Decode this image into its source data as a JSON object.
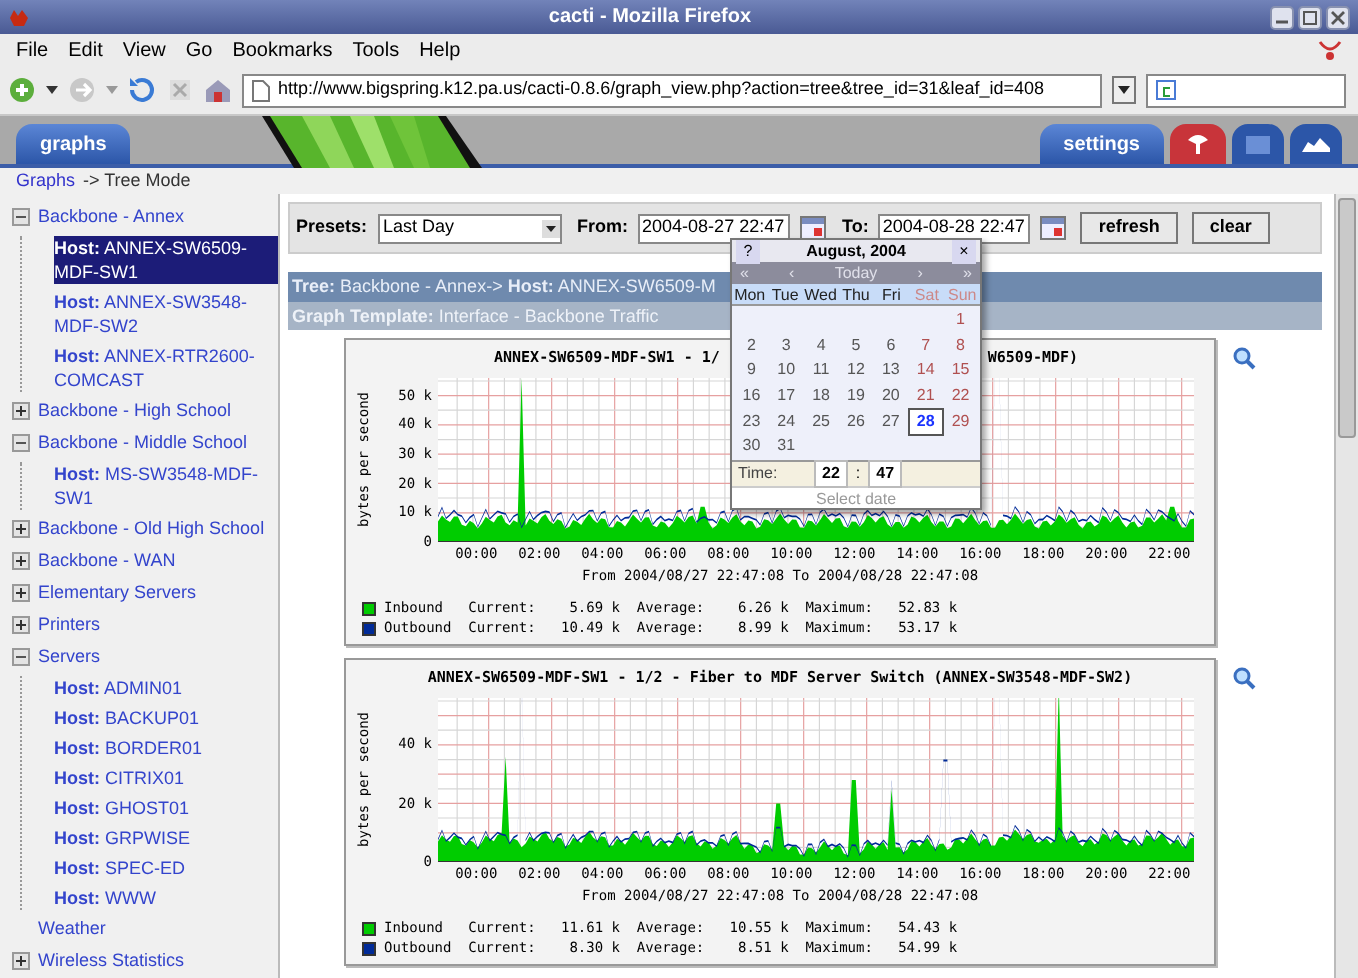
{
  "window": {
    "title": "cacti - Mozilla Firefox"
  },
  "menu": [
    "File",
    "Edit",
    "View",
    "Go",
    "Bookmarks",
    "Tools",
    "Help"
  ],
  "toolbar": {
    "url": "http://www.bigspring.k12.pa.us/cacti-0.8.6/graph_view.php?action=tree&tree_id=31&leaf_id=408"
  },
  "header": {
    "left_tab": "graphs",
    "right_tab": "settings"
  },
  "breadcrumb": {
    "link": "Graphs",
    "text": "-> Tree Mode"
  },
  "tree": [
    {
      "kind": "group",
      "label": "Backbone - Annex",
      "expanded": true,
      "children": [
        {
          "kind": "host",
          "label": "**Host:** ANNEX-SW6509-MDF-SW1",
          "selected": true
        },
        {
          "kind": "host",
          "label": "**Host:** ANNEX-SW3548-MDF-SW2",
          "selected": false
        },
        {
          "kind": "host",
          "label": "**Host:** ANNEX-RTR2600-COMCAST",
          "selected": false
        }
      ]
    },
    {
      "kind": "group",
      "label": "Backbone - High School",
      "expanded": false
    },
    {
      "kind": "group",
      "label": "Backbone - Middle School",
      "expanded": true,
      "children": [
        {
          "kind": "host",
          "label": "**Host:** MS-SW3548-MDF-SW1",
          "selected": false
        }
      ]
    },
    {
      "kind": "group",
      "label": "Backbone - Old High School",
      "expanded": false
    },
    {
      "kind": "group",
      "label": "Backbone - WAN",
      "expanded": false
    },
    {
      "kind": "group",
      "label": "Elementary Servers",
      "expanded": false
    },
    {
      "kind": "group",
      "label": "Printers",
      "expanded": false
    },
    {
      "kind": "group",
      "label": "Servers",
      "expanded": true,
      "children": [
        {
          "kind": "host",
          "label": "**Host:** ADMIN01",
          "selected": false
        },
        {
          "kind": "host",
          "label": "**Host:** BACKUP01",
          "selected": false
        },
        {
          "kind": "host",
          "label": "**Host:** BORDER01",
          "selected": false
        },
        {
          "kind": "host",
          "label": "**Host:** CITRIX01",
          "selected": false
        },
        {
          "kind": "host",
          "label": "**Host:** GHOST01",
          "selected": false
        },
        {
          "kind": "host",
          "label": "**Host:** GRPWISE",
          "selected": false
        },
        {
          "kind": "host",
          "label": "**Host:** SPEC-ED",
          "selected": false
        },
        {
          "kind": "host",
          "label": "**Host:** WWW",
          "selected": false
        }
      ]
    },
    {
      "kind": "leaf",
      "label": "Weather"
    },
    {
      "kind": "group",
      "label": "Wireless Statistics",
      "expanded": false
    }
  ],
  "filter": {
    "presets_label": "Presets:",
    "preset": "Last Day",
    "from_label": "From:",
    "from": "2004-08-27 22:47",
    "to_label": "To:",
    "to": "2004-08-28 22:47",
    "buttons": [
      "refresh",
      "clear"
    ]
  },
  "calendar": {
    "help": "?",
    "title": "August, 2004",
    "close": "×",
    "nav": [
      "«",
      "‹",
      "Today",
      "›",
      "»"
    ],
    "weekdays": [
      {
        "label": "Mon",
        "weekend": false
      },
      {
        "label": "Tue",
        "weekend": false
      },
      {
        "label": "Wed",
        "weekend": false
      },
      {
        "label": "Thu",
        "weekend": false
      },
      {
        "label": "Fri",
        "weekend": false
      },
      {
        "label": "Sat",
        "weekend": true
      },
      {
        "label": "Sun",
        "weekend": true
      }
    ],
    "weeks": [
      [
        {
          "day": "1",
          "weekend": true,
          "selected": false
        }
      ],
      [
        {
          "day": "2",
          "weekend": false,
          "selected": false
        },
        {
          "day": "3",
          "weekend": false,
          "selected": false
        },
        {
          "day": "4",
          "weekend": false,
          "selected": false
        },
        {
          "day": "5",
          "weekend": false,
          "selected": false
        },
        {
          "day": "6",
          "weekend": false,
          "selected": false
        },
        {
          "day": "7",
          "weekend": true,
          "selected": false
        },
        {
          "day": "8",
          "weekend": true,
          "selected": false
        }
      ],
      [
        {
          "day": "9",
          "weekend": false,
          "selected": false
        },
        {
          "day": "10",
          "weekend": false,
          "selected": false
        },
        {
          "day": "11",
          "weekend": false,
          "selected": false
        },
        {
          "day": "12",
          "weekend": false,
          "selected": false
        },
        {
          "day": "13",
          "weekend": false,
          "selected": false
        },
        {
          "day": "14",
          "weekend": true,
          "selected": false
        },
        {
          "day": "15",
          "weekend": true,
          "selected": false
        }
      ],
      [
        {
          "day": "16",
          "weekend": false,
          "selected": false
        },
        {
          "day": "17",
          "weekend": false,
          "selected": false
        },
        {
          "day": "18",
          "weekend": false,
          "selected": false
        },
        {
          "day": "19",
          "weekend": false,
          "selected": false
        },
        {
          "day": "20",
          "weekend": false,
          "selected": false
        },
        {
          "day": "21",
          "weekend": true,
          "selected": false
        },
        {
          "day": "22",
          "weekend": true,
          "selected": false
        }
      ],
      [
        {
          "day": "23",
          "weekend": false,
          "selected": false
        },
        {
          "day": "24",
          "weekend": false,
          "selected": false
        },
        {
          "day": "25",
          "weekend": false,
          "selected": false
        },
        {
          "day": "26",
          "weekend": false,
          "selected": false
        },
        {
          "day": "27",
          "weekend": false,
          "selected": false
        },
        {
          "day": "28",
          "weekend": true,
          "selected": true
        },
        {
          "day": "29",
          "weekend": true,
          "selected": false
        }
      ],
      [
        {
          "day": "30",
          "weekend": false,
          "selected": false
        },
        {
          "day": "31",
          "weekend": false,
          "selected": false
        }
      ]
    ],
    "time_label": "Time:",
    "hour": "22",
    "separator": ":",
    "minute": "47",
    "footer": "Select date"
  },
  "tree_header": "**Tree:** Backbone - Annex-> **Host:** ANNEX-SW6509-M",
  "template_header": "**Graph Template:** Interface - Backbone Traffic",
  "graphs": [
    {
      "title_start": "ANNEX-SW6509-MDF-SW1 - 1/",
      "title_end": "W6509-MDF)",
      "ylabel": "bytes per second",
      "yticks": [
        "50 k",
        "40 k",
        "30 k",
        "20 k",
        "10 k",
        "0"
      ],
      "xticks": [
        "00:00",
        "02:00",
        "04:00",
        "06:00",
        "08:00",
        "10:00",
        "12:00",
        "14:00",
        "16:00",
        "18:00",
        "20:00",
        "22:00"
      ],
      "footer": "From 2004/08/27 22:47:08 To 2004/08/28 22:47:08",
      "legend": [
        {
          "color": "#00cc00",
          "text": "Inbound   Current:    5.69 k  Average:    6.26 k  Maximum:   52.83 k"
        },
        {
          "color": "#002a97",
          "text": "Outbound  Current:   10.49 k  Average:    8.99 k  Maximum:   53.17 k"
        }
      ]
    },
    {
      "title_start": "ANNEX-SW6509-MDF-SW1 - 1/2 - Fiber to MDF Server Switch (ANNEX-SW3548-MDF-SW2)",
      "ylabel": "bytes per second",
      "yticks": [
        "40 k",
        "20 k",
        "0"
      ],
      "xticks": [
        "00:00",
        "02:00",
        "04:00",
        "06:00",
        "08:00",
        "10:00",
        "12:00",
        "14:00",
        "16:00",
        "18:00",
        "20:00",
        "22:00"
      ],
      "footer": "From 2004/08/27 22:47:08 To 2004/08/28 22:47:08",
      "legend": [
        {
          "color": "#00cc00",
          "text": "Inbound   Current:   11.61 k  Average:   10.55 k  Maximum:   54.43 k"
        },
        {
          "color": "#002a97",
          "text": "Outbound  Current:    8.30 k  Average:    8.51 k  Maximum:   54.99 k"
        }
      ]
    }
  ]
}
